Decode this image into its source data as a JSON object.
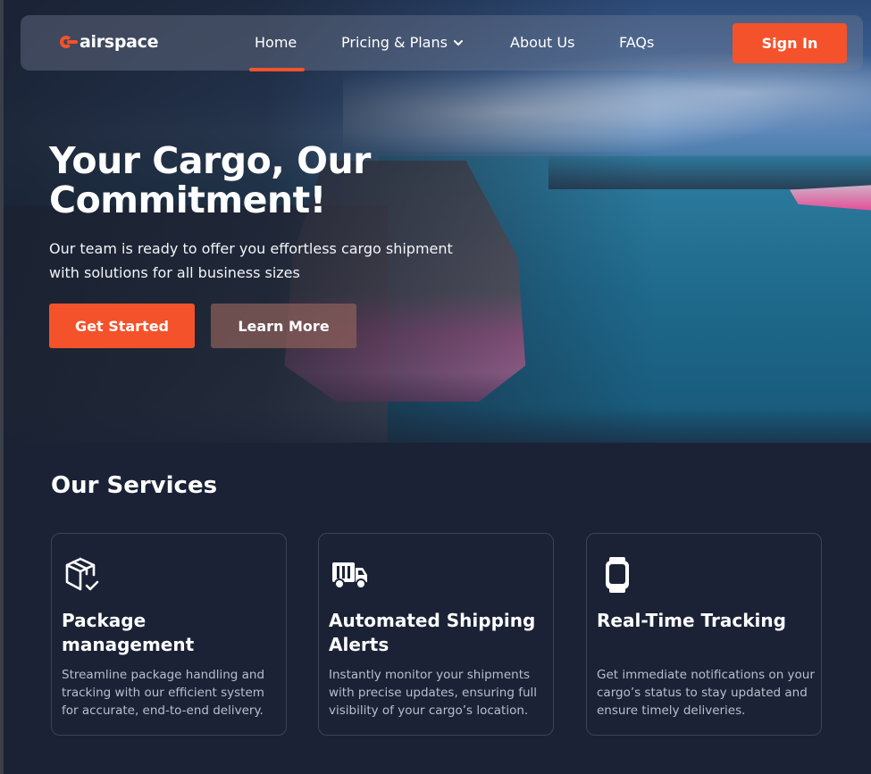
{
  "brand": {
    "name": "airspace",
    "accent_color": "#f4522b",
    "logo_icon": "airspace-logo-icon"
  },
  "nav": {
    "links": [
      {
        "label": "Home",
        "active": true
      },
      {
        "label": "Pricing & Plans",
        "has_dropdown": true
      },
      {
        "label": "About Us"
      },
      {
        "label": "FAQs"
      }
    ],
    "signin_label": "Sign In"
  },
  "hero": {
    "title": "Your Cargo, Our Commitment!",
    "subtitle": "Our team is ready to offer you effortless cargo shipment with solutions for all business sizes",
    "primary_button": "Get Started",
    "secondary_button": "Learn More",
    "background_image": "container-ship-at-port"
  },
  "services": {
    "title": "Our Services",
    "cards": [
      {
        "icon": "package-check-icon",
        "title": "Package management",
        "description": "Streamline package handling and tracking with our efficient system for accurate, end-to-end delivery."
      },
      {
        "icon": "delivery-truck-icon",
        "title": "Automated Shipping Alerts",
        "description": "Instantly monitor your shipments with precise updates, ensuring full visibility of your cargo’s location."
      },
      {
        "icon": "smartwatch-icon",
        "title": "Real-Time Tracking",
        "description": "Get immediate notifications on your cargo’s status to stay updated and ensure timely deliveries."
      }
    ]
  }
}
